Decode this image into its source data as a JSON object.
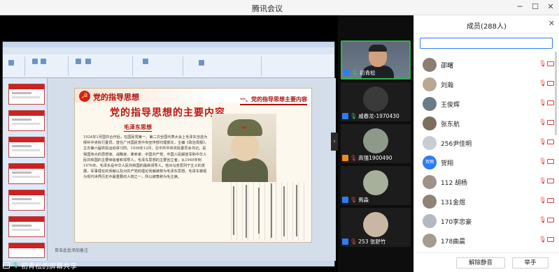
{
  "window": {
    "title": "腾讯会议",
    "minimize": "─",
    "maximize": "☐",
    "close": "✕"
  },
  "slide": {
    "small_title": "党的指导思想",
    "section_heading": "一、党的指导思想主要内容",
    "main_title": "党的指导思想的主要内容",
    "subtitle": "毛泽东思想",
    "body": "1924年1月国共合作后，在国民党第一、第二次全国代表大会上毛泽东当选为候补中央执行委员，曾任广州国民党中央宣传部代理部长，主编《政治周报》，主办第六届农民运动讲习所。1936年12月，在中共中央农民委员会书记。是我国伟大的思想家、战略家、革命家、中国共产党、中国人民解放军和中华人民共和国的主要缔造者和领导人。毛泽东思想的主要创立者。从1949年到1976年，毛泽东是中华人民共和国的最高领导人。他对马克思列宁主义的发展、军事理论的贡献以及对共产党的理论贡献被称为毛泽东思想。毛泽东被视为现代世界历史中最重要的人物之一，所以被尊称为毛主席。",
    "notes": "单击此处添加备注"
  },
  "share_label": "初青松的屏幕共享",
  "videos": [
    {
      "name": "初青松",
      "avatar": "camera",
      "active": true,
      "badge": "blue",
      "mic": "on"
    },
    {
      "name": "戚春龙-1970430",
      "avatar": "dark",
      "active": false,
      "badge": "blue",
      "mic": "on"
    },
    {
      "name": "高强1900490",
      "avatar": "photo",
      "active": false,
      "badge": "orange",
      "mic": "off"
    },
    {
      "name": "焉淼",
      "avatar": "photo",
      "active": false,
      "badge": "blue",
      "mic": "off"
    },
    {
      "name": "253 张舒竹",
      "avatar": "photo",
      "active": false,
      "badge": "blue",
      "mic": "off"
    }
  ],
  "members_panel": {
    "title": "成员(288人)",
    "close_icon": "close-icon",
    "members": [
      {
        "name": "邵曙",
        "avatar_color": "#8a7f72"
      },
      {
        "name": "刘瀚",
        "avatar_color": "#b9a793"
      },
      {
        "name": "王俊辉",
        "avatar_color": "#6b7b86"
      },
      {
        "name": "张东航",
        "avatar_color": "#7d6d5c"
      },
      {
        "name": "256尹佳明",
        "avatar_color": "#c8cdd3"
      },
      {
        "name": "贺翔",
        "avatar_color": "#2d7cf6",
        "avatar_text": "贺翔"
      },
      {
        "name": "112 胡杨",
        "avatar_color": "#9e9289"
      },
      {
        "name": "131金煜",
        "avatar_color": "#8f8374"
      },
      {
        "name": "170李忠豪",
        "avatar_color": "#b3b9bf"
      },
      {
        "name": "178曲晨",
        "avatar_color": "#a69b90"
      }
    ],
    "unmute_all": "解除静音",
    "raise_hand": "举手"
  }
}
